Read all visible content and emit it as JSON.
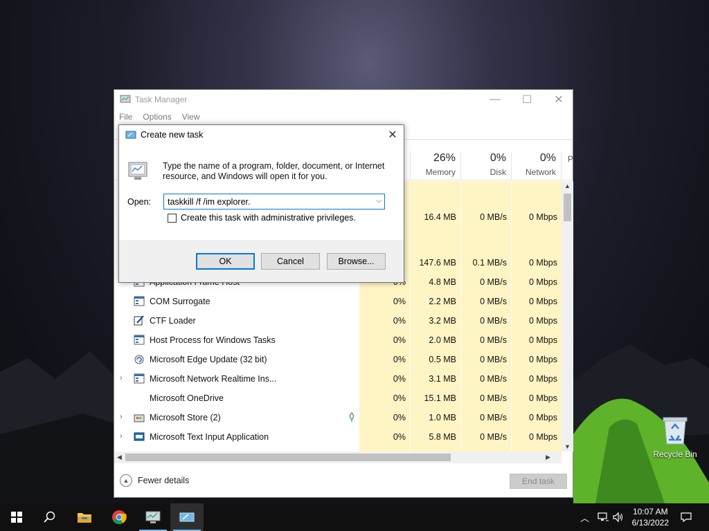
{
  "desktop": {
    "recycle_bin_label": "Recycle Bin"
  },
  "task_manager": {
    "title": "Task Manager",
    "menu": [
      "File",
      "Options",
      "View"
    ],
    "columns": [
      {
        "pct": "26%",
        "label": "Memory"
      },
      {
        "pct": "0%",
        "label": "Disk"
      },
      {
        "pct": "0%",
        "label": "Network"
      },
      {
        "pct": "",
        "label": "P"
      }
    ],
    "hidden_rows": [
      {
        "memory": "16.4 MB",
        "disk": "0 MB/s",
        "network": "0 Mbps"
      },
      {
        "memory": "147.6 MB",
        "disk": "0.1 MB/s",
        "network": "0 Mbps"
      }
    ],
    "processes": [
      {
        "name": "Application Frame Host",
        "cpu": "0%",
        "memory": "4.8 MB",
        "disk": "0 MB/s",
        "network": "0 Mbps",
        "expand": "",
        "icon": "app-window-icon"
      },
      {
        "name": "COM Surrogate",
        "cpu": "0%",
        "memory": "2.2 MB",
        "disk": "0 MB/s",
        "network": "0 Mbps",
        "expand": "",
        "icon": "app-window-icon"
      },
      {
        "name": "CTF Loader",
        "cpu": "0%",
        "memory": "3.2 MB",
        "disk": "0 MB/s",
        "network": "0 Mbps",
        "expand": "",
        "icon": "pen-notepad-icon"
      },
      {
        "name": "Host Process for Windows Tasks",
        "cpu": "0%",
        "memory": "2.0 MB",
        "disk": "0 MB/s",
        "network": "0 Mbps",
        "expand": "",
        "icon": "app-window-icon"
      },
      {
        "name": "Microsoft Edge Update (32 bit)",
        "cpu": "0%",
        "memory": "0.5 MB",
        "disk": "0 MB/s",
        "network": "0 Mbps",
        "expand": "",
        "icon": "update-icon"
      },
      {
        "name": "Microsoft Network Realtime Ins...",
        "cpu": "0%",
        "memory": "3.1 MB",
        "disk": "0 MB/s",
        "network": "0 Mbps",
        "expand": "›",
        "icon": "app-window-icon"
      },
      {
        "name": "Microsoft OneDrive",
        "cpu": "0%",
        "memory": "15.1 MB",
        "disk": "0 MB/s",
        "network": "0 Mbps",
        "expand": "",
        "icon": ""
      },
      {
        "name": "Microsoft Store (2)",
        "cpu": "0%",
        "memory": "1.0 MB",
        "disk": "0 MB/s",
        "network": "0 Mbps",
        "expand": "›",
        "icon": "store-icon"
      },
      {
        "name": "Microsoft Text Input Application",
        "cpu": "0%",
        "memory": "5.8 MB",
        "disk": "0 MB/s",
        "network": "0 Mbps",
        "expand": "›",
        "icon": "keyboard-icon"
      }
    ],
    "fewer_details": "Fewer details",
    "end_task": "End task"
  },
  "run_dialog": {
    "title": "Create new task",
    "description": "Type the name of a program, folder, document, or Internet resource, and Windows will open it for you.",
    "open_label": "Open:",
    "open_value": "taskkill /f /im explorer.",
    "admin_checkbox_label": "Create this task with administrative privileges.",
    "admin_checked": false,
    "ok_label": "OK",
    "cancel_label": "Cancel",
    "browse_label": "Browse..."
  },
  "taskbar": {
    "items": [
      "start-icon",
      "search-icon",
      "file-explorer-icon",
      "chrome-icon",
      "task-manager-icon",
      "run-dialog-icon"
    ],
    "time": "10:07 AM",
    "date": "6/13/2022",
    "accent": "#76b9ed"
  }
}
